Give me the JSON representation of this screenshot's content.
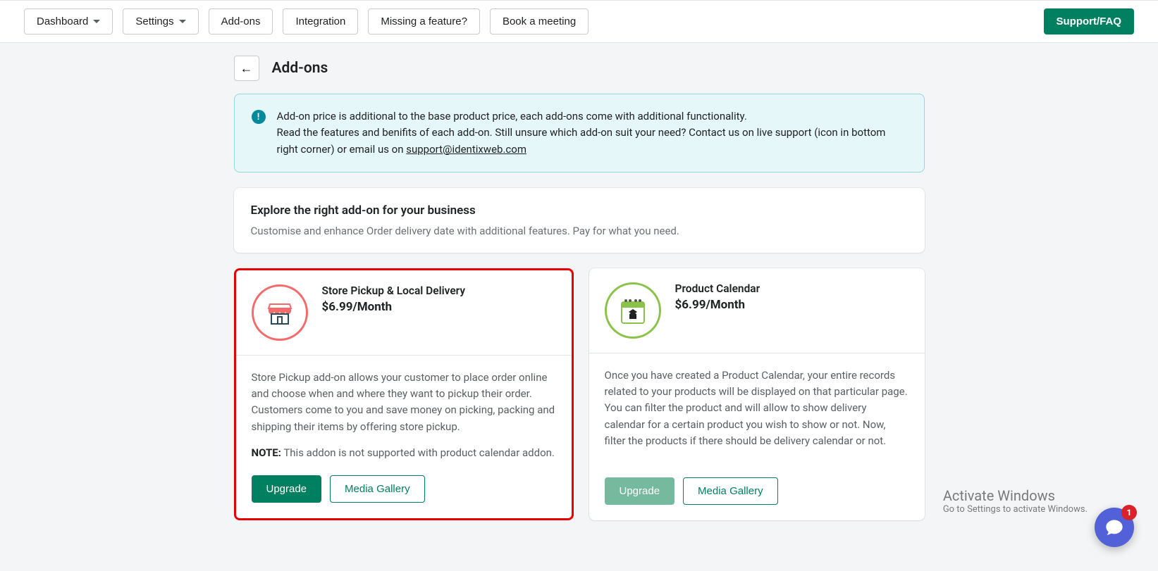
{
  "nav": {
    "dashboard": "Dashboard",
    "settings": "Settings",
    "addons": "Add-ons",
    "integration": "Integration",
    "missing": "Missing a feature?",
    "book": "Book a meeting",
    "support": "Support/FAQ"
  },
  "page": {
    "title": "Add-ons",
    "back_arrow": "←"
  },
  "banner": {
    "icon": "!",
    "line1": "Add-on price is additional to the base product price, each add-ons come with additional functionality.",
    "line2a": "Read the features and benifits of each add-on. Still unsure which add-on suit your need? Contact us on live support (icon in bottom right corner) or email us on ",
    "email": "support@identixweb.com"
  },
  "intro": {
    "title": "Explore the right add-on for your business",
    "sub": "Customise and enhance Order delivery date with additional features. Pay for what you need."
  },
  "addons": [
    {
      "name": "Store Pickup & Local Delivery",
      "price": "$6.99/Month",
      "desc": "Store Pickup add-on allows your customer to place order online and choose when and where they want to pickup their order. Customers come to you and save money on picking, packing and shipping their items by offering store pickup.",
      "note_label": "NOTE:",
      "note_text": " This addon is not supported with product calendar addon.",
      "upgrade": "Upgrade",
      "gallery": "Media Gallery"
    },
    {
      "name": "Product Calendar",
      "price": "$6.99/Month",
      "desc": "Once you have created a Product Calendar, your entire records related to your products will be displayed on that particular page. You can filter the product and will allow to show delivery calendar for a certain product you wish to show or not. Now, filter the products if there should be delivery calendar or not.",
      "upgrade": "Upgrade",
      "gallery": "Media Gallery"
    }
  ],
  "watermark": {
    "line1": "Activate Windows",
    "line2": "Go to Settings to activate Windows."
  },
  "chat": {
    "badge": "1"
  }
}
